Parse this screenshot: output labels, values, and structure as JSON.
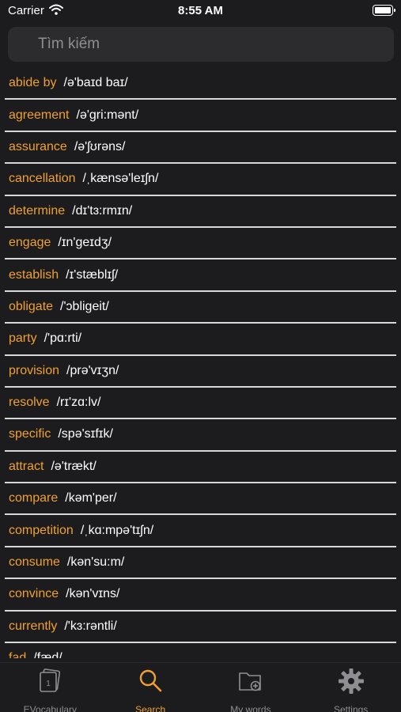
{
  "status_bar": {
    "carrier": "Carrier",
    "time": "8:55 AM"
  },
  "search": {
    "placeholder": "Tìm kiếm",
    "value": ""
  },
  "words": [
    {
      "word": "abide by",
      "pron": "/ə'baɪd baɪ/"
    },
    {
      "word": "agreement",
      "pron": "/ə'gri:mənt/"
    },
    {
      "word": "assurance",
      "pron": "/ə'ʃʊrəns/"
    },
    {
      "word": "cancellation",
      "pron": "/ˌkænsə'leɪʃn/"
    },
    {
      "word": "determine",
      "pron": "/dɪ'tɜ:rmɪn/"
    },
    {
      "word": "engage",
      "pron": "/ɪn'geɪdʒ/"
    },
    {
      "word": "establish",
      "pron": "/ɪ'stæblɪʃ/"
    },
    {
      "word": "obligate",
      "pron": "/'ɔbligeit/"
    },
    {
      "word": "party",
      "pron": "/'pɑ:rti/"
    },
    {
      "word": "provision",
      "pron": "/prə'vɪʒn/"
    },
    {
      "word": "resolve",
      "pron": "/rɪ'zɑ:lv/"
    },
    {
      "word": "specific",
      "pron": "/spə'sɪfɪk/"
    },
    {
      "word": "attract",
      "pron": "/ə'trækt/"
    },
    {
      "word": "compare",
      "pron": "/kəm'per/"
    },
    {
      "word": "competition",
      "pron": "/ˌkɑ:mpə'tɪʃn/"
    },
    {
      "word": "consume",
      "pron": "/kən'su:m/"
    },
    {
      "word": "convince",
      "pron": "/kən'vɪns/"
    },
    {
      "word": "currently",
      "pron": "/'kɜ:rəntli/"
    },
    {
      "word": "fad",
      "pron": "/fæd/"
    }
  ],
  "tabs": [
    {
      "label": "EVocabulary",
      "icon": "flashcards-icon",
      "active": false
    },
    {
      "label": "Search",
      "icon": "search-icon",
      "active": true
    },
    {
      "label": "My words",
      "icon": "folder-add-icon",
      "active": false
    },
    {
      "label": "Settings",
      "icon": "gear-icon",
      "active": false
    }
  ],
  "colors": {
    "accent": "#f0a030",
    "background": "#1c1c1e",
    "inactive": "#8e8e93"
  }
}
